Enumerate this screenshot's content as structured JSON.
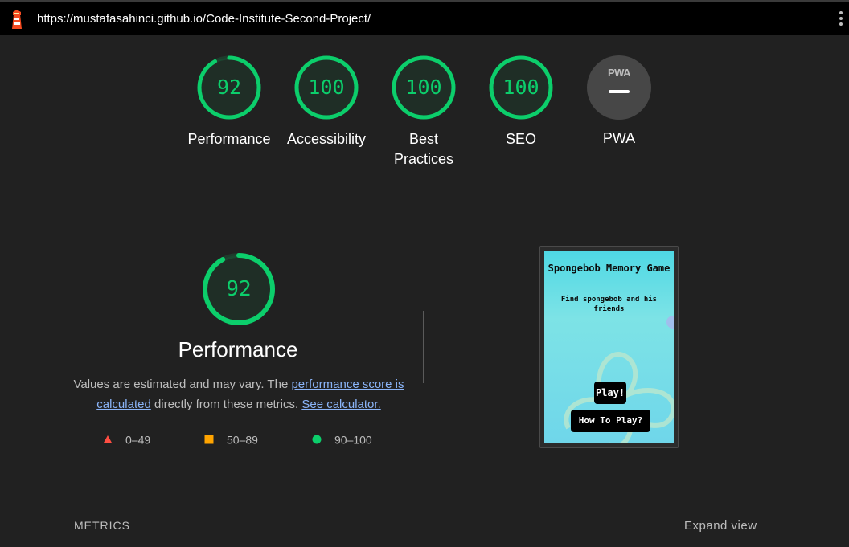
{
  "browser": {
    "url": "https://mustafasahinci.github.io/Code-Institute-Second-Project/",
    "logo_icon": "lighthouse-icon",
    "menu_icon": "more-vert-icon"
  },
  "colors": {
    "pass": "#0cce6b",
    "average": "#ffa400",
    "fail": "#ff4e42",
    "background": "#212121"
  },
  "gauges": [
    {
      "label": "Performance",
      "score": "92",
      "fraction": 0.92
    },
    {
      "label": "Accessibility",
      "score": "100",
      "fraction": 1.0
    },
    {
      "label": "Best Practices",
      "score": "100",
      "fraction": 1.0
    },
    {
      "label": "SEO",
      "score": "100",
      "fraction": 1.0
    },
    {
      "label": "PWA",
      "badge": "PWA"
    }
  ],
  "performance": {
    "score": "92",
    "fraction": 0.92,
    "title": "Performance",
    "desc_prefix": "Values are estimated and may vary. The ",
    "link_score": "performance score is calculated",
    "desc_middle": " directly from these metrics. ",
    "link_calc": "See calculator.",
    "legend": [
      {
        "range": "0–49",
        "icon": "fail-triangle-icon"
      },
      {
        "range": "50–89",
        "icon": "average-square-icon"
      },
      {
        "range": "90–100",
        "icon": "pass-circle-icon"
      }
    ]
  },
  "screenshot": {
    "title": "Spongebob Memory Game",
    "subtitle": "Find spongebob and his friends",
    "play": "Play!",
    "how": "How To Play?"
  },
  "metrics": {
    "heading": "METRICS",
    "expand": "Expand view"
  }
}
